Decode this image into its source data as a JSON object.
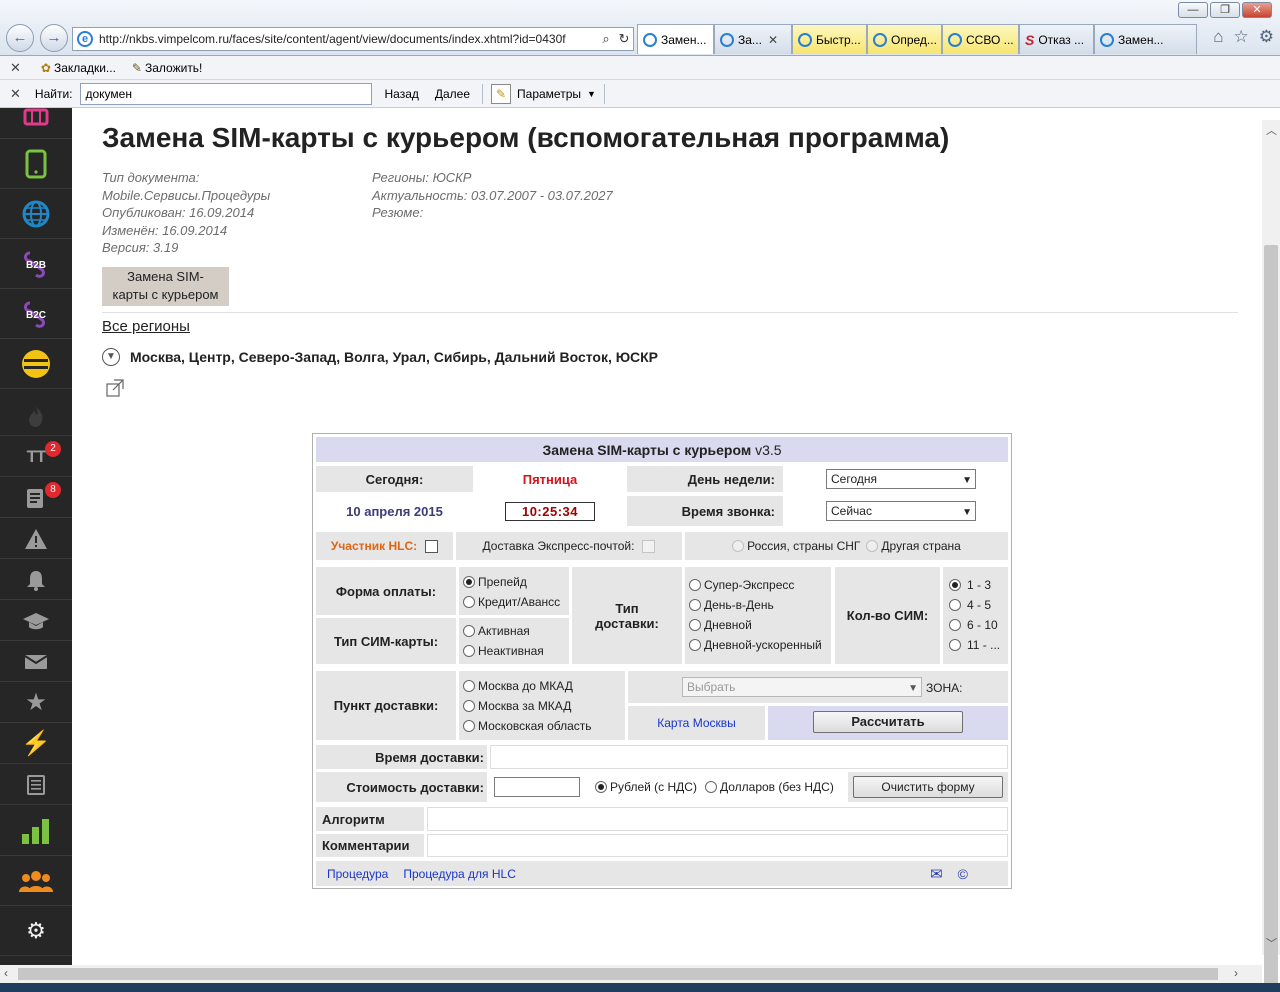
{
  "browser": {
    "url": "http://nkbs.vimpelcom.ru/faces/site/content/agent/view/documents/index.xhtml?id=0430f",
    "tabs": [
      {
        "label": "Замен..."
      },
      {
        "label": "За..."
      },
      {
        "label": "Быстр..."
      },
      {
        "label": "Опред..."
      },
      {
        "label": "ССВО ..."
      },
      {
        "label": "Отказ ..."
      },
      {
        "label": "Замен..."
      }
    ],
    "favorites": {
      "bookmarks_label": "Закладки...",
      "add_label": "Заложить!"
    },
    "find": {
      "label": "Найти:",
      "value": "докумен",
      "back_label": "Назад",
      "next_label": "Далее",
      "params_label": "Параметры"
    }
  },
  "sidebar": {
    "badges": {
      "tt": "2",
      "news": "8"
    },
    "labels": {
      "b2b": "B2B",
      "b2c": "B2C"
    }
  },
  "document": {
    "title": "Замена SIM-карты с курьером (вспомогательная программа)",
    "meta_left": [
      "Тип документа:",
      "Mobile.Сервисы.Процедуры",
      "Опубликован:  16.09.2014",
      "Изменён:  16.09.2014",
      "Версия:  3.19"
    ],
    "meta_right": [
      "Регионы:  ЮСКР",
      "Актуальность:  03.07.2007 - 03.07.2027",
      "Резюме:"
    ],
    "tag_line1": "Замена SIM-",
    "tag_line2": "карты с курьером",
    "all_regions": "Все регионы",
    "regions": "Москва, Центр, Северо-Запад, Волга, Урал, Сибирь, Дальний Восток, ЮСКР"
  },
  "form": {
    "title": "Замена SIM-карты с курьером",
    "version": "v3.5",
    "today_label": "Сегодня:",
    "weekday_value": "Пятница",
    "day_label": "День недели:",
    "day_select": "Сегодня",
    "date_value": "10 апреля 2015",
    "time_value": "10:25:34",
    "call_time_label": "Время звонка:",
    "call_time_select": "Сейчас",
    "hlc_label": "Участник HLC:",
    "express_label": "Доставка Экспресс-почтой:",
    "country_options": [
      "Россия, страны СНГ",
      "Другая страна"
    ],
    "payment_label": "Форма оплаты:",
    "payment_options": [
      "Препейд",
      "Кредит/Авансс"
    ],
    "sim_type_label": "Тип СИМ-карты:",
    "sim_type_options": [
      "Активная",
      "Неактивная"
    ],
    "delivery_type_label_1": "Тип",
    "delivery_type_label_2": "доставки:",
    "delivery_type_options": [
      "Супер-Экспресс",
      "День-в-День",
      "Дневной",
      "Дневной-ускоренный"
    ],
    "sim_count_label": "Кол-во СИМ:",
    "sim_count_options": [
      "1 - 3",
      "4 - 5",
      "6 - 10",
      "11 - ..."
    ],
    "point_label": "Пункт доставки:",
    "point_options": [
      "Москва до МКАД",
      "Москва за МКАД",
      "Московская область"
    ],
    "zone_select": "Выбрать",
    "zone_label": "ЗОНА:",
    "map_link": "Карта Москвы",
    "calc_button": "Рассчитать",
    "delivery_time_label": "Время доставки:",
    "delivery_cost_label": "Стоимость доставки:",
    "currency_options": [
      "Рублей (с НДС)",
      "Долларов (без НДС)"
    ],
    "clear_button": "Очистить форму",
    "algorithm_label": "Алгоритм",
    "comments_label": "Комментарии",
    "footer_links": [
      "Процедура",
      "Процедура для HLC"
    ],
    "copyright": "©"
  },
  "colors": {
    "sidebar_bg": "#262626",
    "icon_green": "#7cc242",
    "icon_blue": "#1e88c8",
    "icon_purple": "#8a4bb8",
    "icon_yellow": "#f2c314",
    "icon_orange": "#f08c1e",
    "weekday_red": "#d4121a",
    "hlc_orange": "#e06510",
    "date_blue": "#3c3c78",
    "time_red": "#a00000",
    "link_blue": "#1a35c9"
  }
}
